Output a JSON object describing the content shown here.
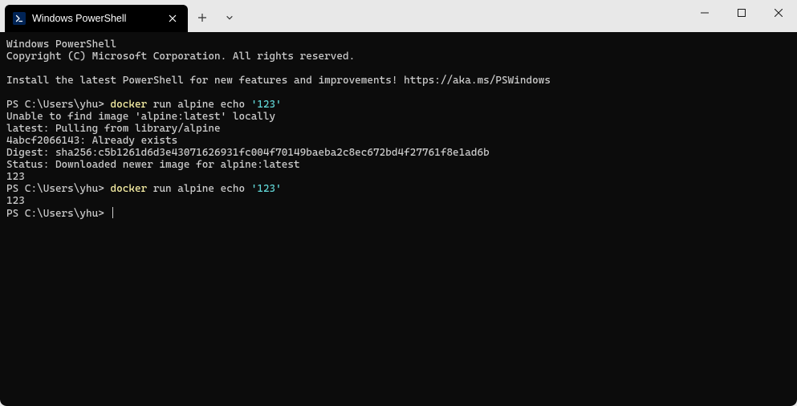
{
  "tab": {
    "title": "Windows PowerShell"
  },
  "terminal": {
    "lines": [
      [
        {
          "t": "Windows PowerShell",
          "c": ""
        }
      ],
      [
        {
          "t": "Copyright (C) Microsoft Corporation. All rights reserved.",
          "c": ""
        }
      ],
      [
        {
          "t": "",
          "c": ""
        }
      ],
      [
        {
          "t": "Install the latest PowerShell for new features and improvements! https://aka.ms/PSWindows",
          "c": ""
        }
      ],
      [
        {
          "t": "",
          "c": ""
        }
      ],
      [
        {
          "t": "PS C:\\Users\\yhu> ",
          "c": ""
        },
        {
          "t": "docker",
          "c": "yellow"
        },
        {
          "t": " run alpine echo ",
          "c": ""
        },
        {
          "t": "'123'",
          "c": "cyan"
        }
      ],
      [
        {
          "t": "Unable to find image 'alpine:latest' locally",
          "c": ""
        }
      ],
      [
        {
          "t": "latest: Pulling from library/alpine",
          "c": ""
        }
      ],
      [
        {
          "t": "4abcf2066143: Already exists",
          "c": ""
        }
      ],
      [
        {
          "t": "Digest: sha256:c5b1261d6d3e43071626931fc004f70149baeba2c8ec672bd4f27761f8e1ad6b",
          "c": ""
        }
      ],
      [
        {
          "t": "Status: Downloaded newer image for alpine:latest",
          "c": ""
        }
      ],
      [
        {
          "t": "123",
          "c": ""
        }
      ],
      [
        {
          "t": "PS C:\\Users\\yhu> ",
          "c": ""
        },
        {
          "t": "docker",
          "c": "yellow"
        },
        {
          "t": " run alpine echo ",
          "c": ""
        },
        {
          "t": "'123'",
          "c": "cyan"
        }
      ],
      [
        {
          "t": "123",
          "c": ""
        }
      ],
      [
        {
          "t": "PS C:\\Users\\yhu> ",
          "c": ""
        },
        {
          "t": "__CURSOR__",
          "c": ""
        }
      ]
    ]
  }
}
